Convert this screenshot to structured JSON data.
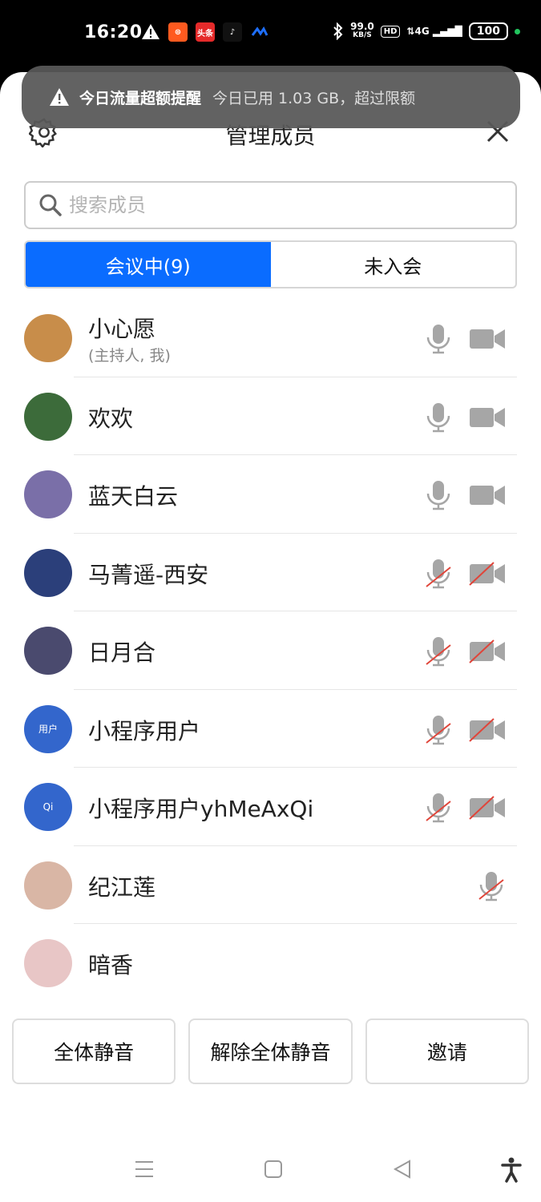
{
  "status_bar": {
    "time": "16:20",
    "speed_top": "99.0",
    "speed_unit": "KB/S",
    "hd": "HD",
    "network": "4G",
    "battery": "100",
    "app_icons": [
      {
        "name": "warning-icon"
      },
      {
        "name": "kuaishou-icon",
        "text": "",
        "color": "#ff5a1f"
      },
      {
        "name": "toutiao-icon",
        "text": "头条",
        "color": "#e52a2a"
      },
      {
        "name": "tiktok-icon",
        "text": "♪",
        "color": "#111111"
      },
      {
        "name": "meeting-icon",
        "text": "",
        "color": "#1e6fff"
      }
    ]
  },
  "toast": {
    "title": "今日流量超额提醒",
    "message": "今日已用 1.03 GB，超过限额"
  },
  "header": {
    "title": "管理成员"
  },
  "search": {
    "placeholder": "搜索成员"
  },
  "tabs": [
    {
      "label": "会议中(9)",
      "active": true
    },
    {
      "label": "未入会",
      "active": false
    }
  ],
  "members": [
    {
      "name": "小心愿",
      "subtitle": "(主持人, 我)",
      "mic": "on",
      "camera": "on",
      "avatar_bg": "#c88d4a",
      "avatar_text": ""
    },
    {
      "name": "欢欢",
      "mic": "on",
      "camera": "on",
      "avatar_bg": "#3c6b3a",
      "avatar_text": ""
    },
    {
      "name": "蓝天白云",
      "mic": "on",
      "camera": "on",
      "avatar_bg": "#7a6fa8",
      "avatar_text": ""
    },
    {
      "name": "马菁遥-西安",
      "mic": "off",
      "camera": "off",
      "avatar_bg": "#2b3f7a",
      "avatar_text": ""
    },
    {
      "name": "日月合",
      "mic": "off",
      "camera": "off",
      "avatar_bg": "#4a4a6e",
      "avatar_text": ""
    },
    {
      "name": "小程序用户",
      "mic": "off",
      "camera": "off",
      "avatar_bg": "#3366cc",
      "avatar_text": "用户"
    },
    {
      "name": "小程序用户yhMeAxQi",
      "mic": "off",
      "camera": "off",
      "avatar_bg": "#3366cc",
      "avatar_text": "Qi"
    },
    {
      "name": "纪江莲",
      "mic": "off",
      "camera": "none",
      "avatar_bg": "#d9b6a5",
      "avatar_text": ""
    },
    {
      "name": "暗香",
      "mic": "none",
      "camera": "none",
      "avatar_bg": "#e8c6c6",
      "avatar_text": ""
    }
  ],
  "actions": {
    "mute_all": "全体静音",
    "unmute_all": "解除全体静音",
    "invite": "邀请"
  },
  "colors": {
    "accent": "#0a6cff",
    "icon_gray": "#a6a6a6",
    "muted_red": "#e0453a"
  }
}
